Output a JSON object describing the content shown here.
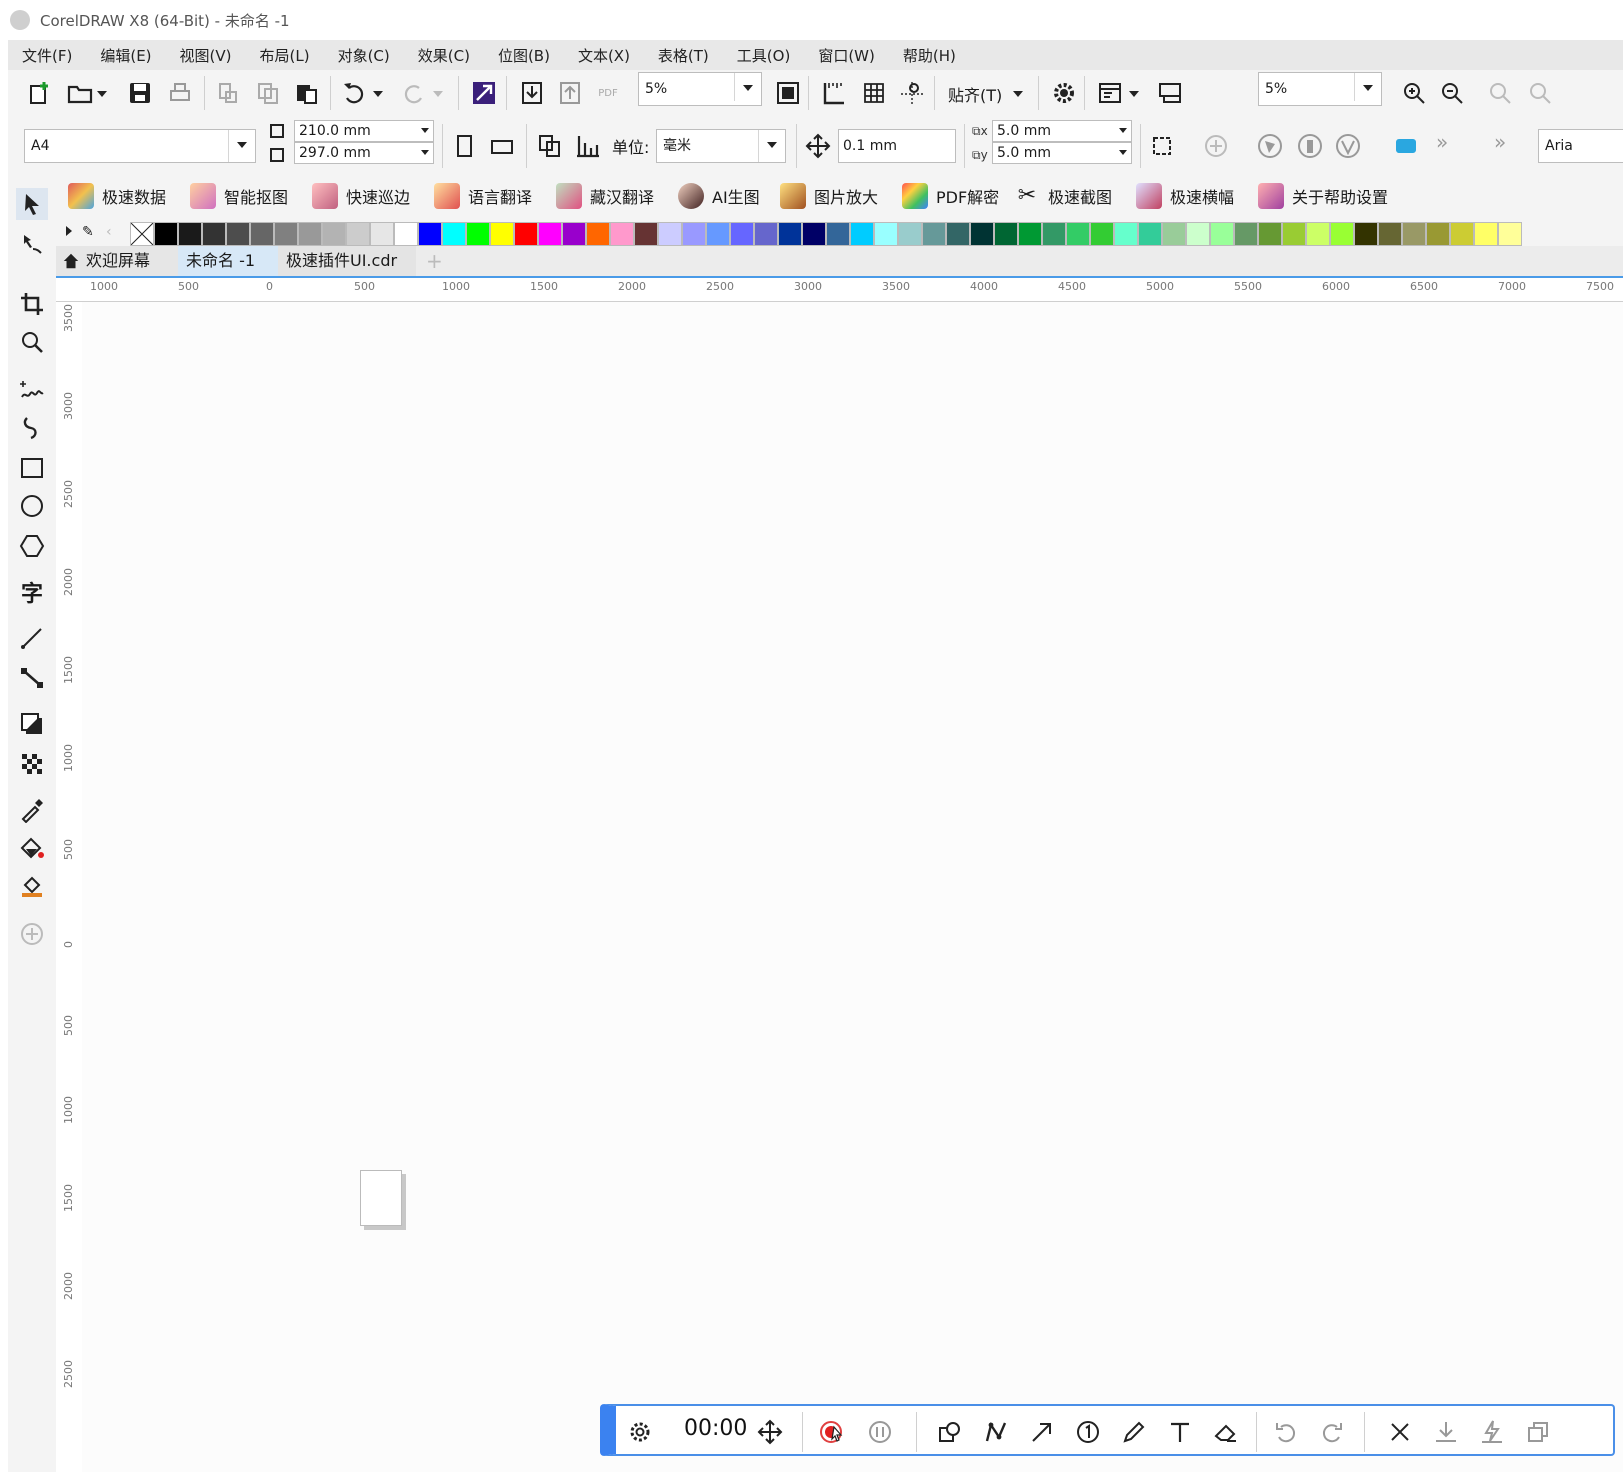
{
  "window": {
    "title": "CorelDRAW X8 (64-Bit) - 未命名 -1"
  },
  "menu": [
    "文件(F)",
    "编辑(E)",
    "视图(V)",
    "布局(L)",
    "对象(C)",
    "效果(C)",
    "位图(B)",
    "文本(X)",
    "表格(T)",
    "工具(O)",
    "窗口(W)",
    "帮助(H)"
  ],
  "toolbar": {
    "zoom": "5%",
    "snap_label": "贴齐(T)",
    "zoom2": "5%",
    "pdf_label": "PDF"
  },
  "property_bar": {
    "page_size": "A4",
    "width": "210.0 mm",
    "height": "297.0 mm",
    "unit_label": "单位:",
    "unit_value": "毫米",
    "nudge": "0.1 mm",
    "dup_x": "5.0 mm",
    "dup_y": "5.0 mm",
    "font_partial": "Aria"
  },
  "plugins": [
    "极速数据",
    "智能抠图",
    "快速巡边",
    "语言翻译",
    "藏汉翻译",
    "AI生图",
    "图片放大",
    "PDF解密",
    "极速截图",
    "极速横幅",
    "关于帮助设置"
  ],
  "palette": [
    "#000000",
    "#1a1a1a",
    "#333333",
    "#4d4d4d",
    "#666666",
    "#808080",
    "#999999",
    "#b3b3b3",
    "#cccccc",
    "#e6e6e6",
    "#ffffff",
    "#0000ff",
    "#00ffff",
    "#00ff00",
    "#ffff00",
    "#ff0000",
    "#ff00ff",
    "#9900cc",
    "#ff6600",
    "#ff99cc",
    "#663333",
    "#ccccff",
    "#9999ff",
    "#6699ff",
    "#6666ff",
    "#6666cc",
    "#003399",
    "#000066",
    "#336699",
    "#00ccff",
    "#99ffff",
    "#99cccc",
    "#669999",
    "#336666",
    "#003333",
    "#006633",
    "#009933",
    "#339966",
    "#33cc66",
    "#33cc33",
    "#66ffcc",
    "#33cc99",
    "#99cc99",
    "#ccffcc",
    "#99ff99",
    "#669966",
    "#669933",
    "#99cc33",
    "#ccff66",
    "#99ff33",
    "#333300",
    "#666633",
    "#999966",
    "#999933",
    "#cccc33",
    "#ffff66",
    "#ffff99"
  ],
  "tabs": [
    "欢迎屏幕",
    "未命名 -1",
    "极速插件UI.cdr"
  ],
  "hruler": [
    "1000",
    "500",
    "0",
    "500",
    "1000",
    "1500",
    "2000",
    "2500",
    "3000",
    "3500",
    "4000",
    "4500",
    "5000",
    "5500",
    "6000",
    "6500",
    "7000",
    "7500"
  ],
  "vruler": [
    "3500",
    "3000",
    "2500",
    "2000",
    "1500",
    "1000",
    "500",
    "0",
    "500",
    "1000",
    "1500",
    "2000",
    "2500"
  ],
  "recorder": {
    "time": "00:00"
  }
}
